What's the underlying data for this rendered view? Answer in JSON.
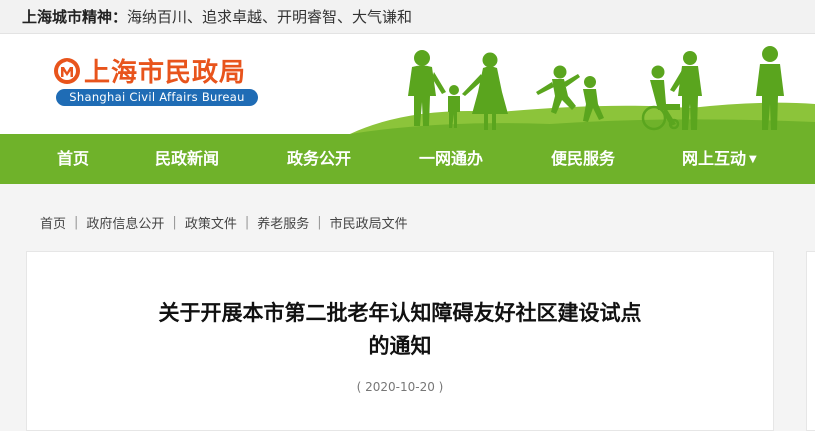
{
  "topbar": {
    "label": "上海城市精神：",
    "motto": "海纳百川、追求卓越、开明睿智、大气谦和"
  },
  "logo": {
    "cn": "上海市民政局",
    "en": "Shanghai Civil Affairs Bureau",
    "emblem_icon": "civil-affairs-emblem-icon"
  },
  "colors": {
    "nav_green": "#6fb22a",
    "logo_orange": "#e8541c",
    "logo_blue": "#1f6cb5",
    "silhouette_green": "#5aa51e"
  },
  "nav": {
    "items": [
      {
        "label": "首页"
      },
      {
        "label": "民政新闻"
      },
      {
        "label": "政务公开"
      },
      {
        "label": "一网通办"
      },
      {
        "label": "便民服务"
      },
      {
        "label": "网上互动",
        "has_dropdown": true
      }
    ]
  },
  "breadcrumb": [
    "首页",
    "政府信息公开",
    "政策文件",
    "养老服务",
    "市民政局文件"
  ],
  "article": {
    "title_line1": "关于开展本市第二批老年认知障碍友好社区建设试点",
    "title_line2": "的通知",
    "date": "( 2020-10-20 )"
  }
}
